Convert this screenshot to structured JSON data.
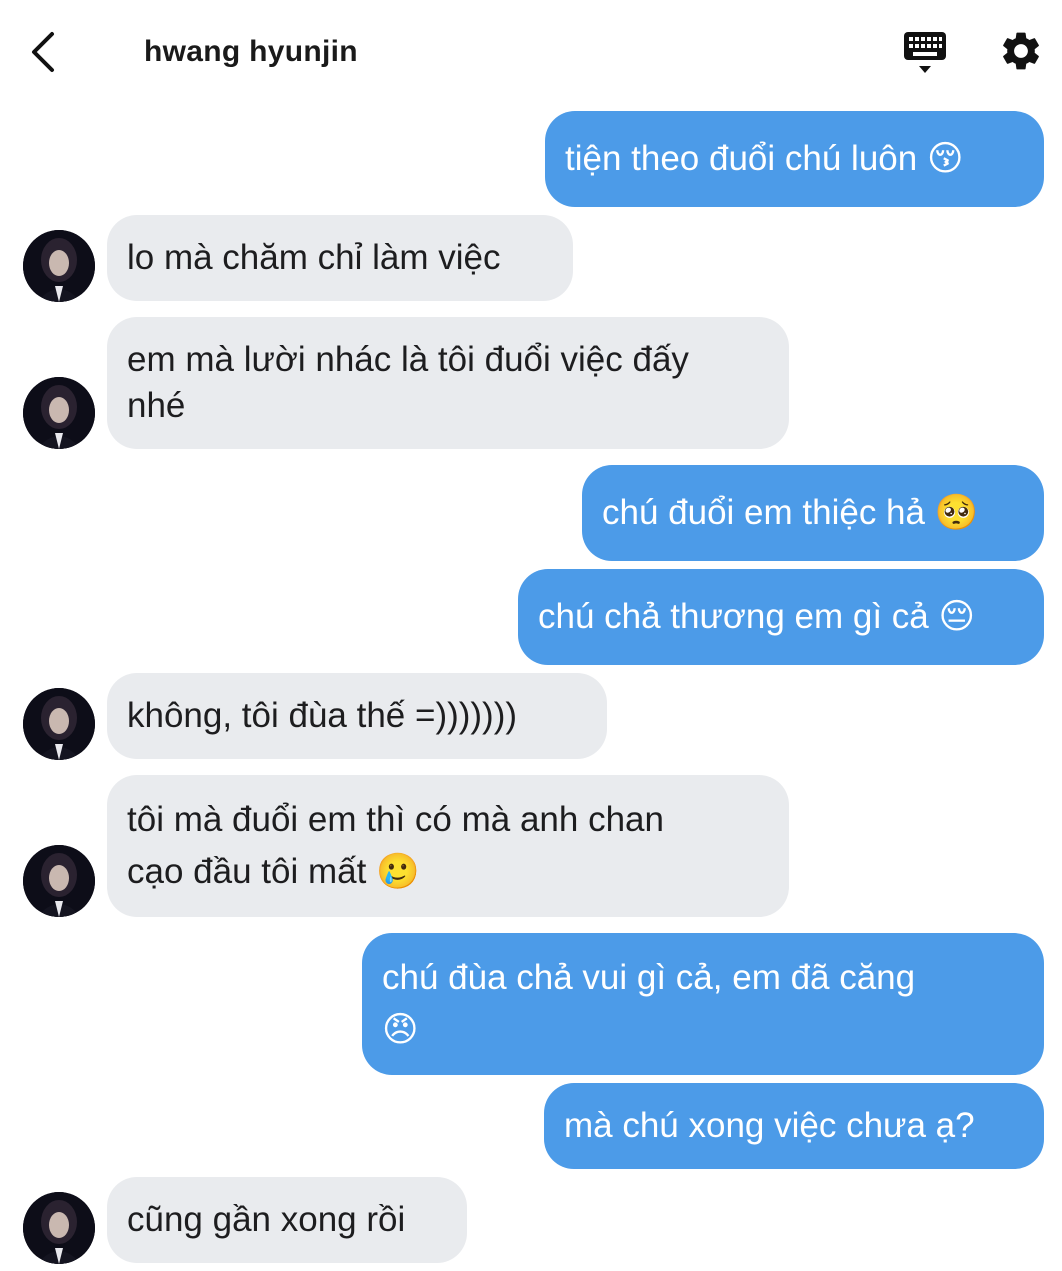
{
  "header": {
    "title": "hwang hyunjin",
    "back_icon": "chevron-left-icon",
    "keyboard_icon": "keyboard-icon",
    "settings_icon": "gear-icon"
  },
  "colors": {
    "sent_bubble": "#4c9be8",
    "received_bubble": "#e9ebee",
    "background": "#ffffff"
  },
  "messages": [
    {
      "from": "me",
      "text": "tiện theo đuổi chú luôn 😚"
    },
    {
      "from": "them",
      "text": "lo mà chăm chỉ làm việc"
    },
    {
      "from": "them",
      "line1": "em mà lười nhác là tôi đuổi việc đấy",
      "line2": "nhé"
    },
    {
      "from": "me",
      "text": "chú đuổi em thiệc hả 🥺"
    },
    {
      "from": "me",
      "text": "chú chả thương em gì cả 😔"
    },
    {
      "from": "them",
      "text": "không, tôi đùa thế =)))))))"
    },
    {
      "from": "them",
      "line1": "tôi mà đuổi em thì có mà anh chan",
      "line2": "cạo đầu tôi mất 🥲"
    },
    {
      "from": "me",
      "line1": "chú đùa chả vui gì cả, em đã căng",
      "line2": "😠"
    },
    {
      "from": "me",
      "text": "mà chú xong việc chưa ạ?"
    },
    {
      "from": "them",
      "text": "cũng gần xong rồi"
    }
  ]
}
